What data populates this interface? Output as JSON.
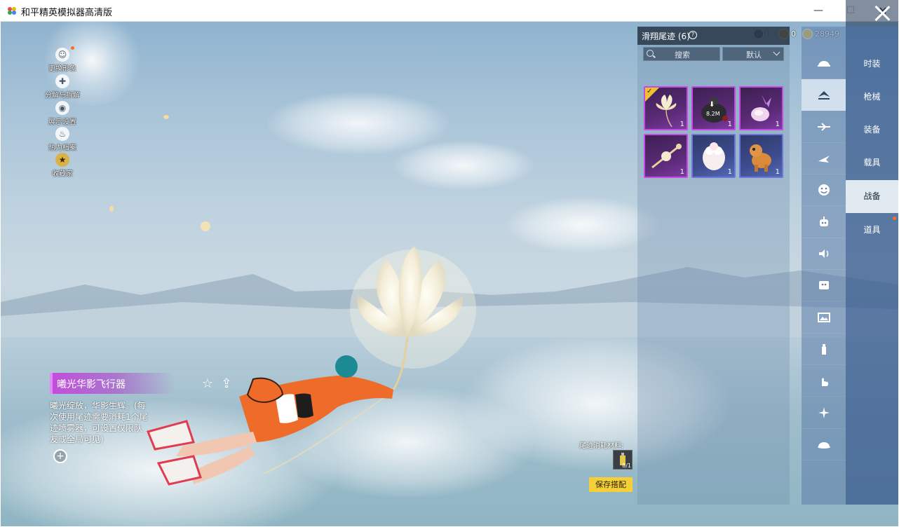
{
  "window": {
    "title": "和平精英模拟器高清版",
    "minimize": "—",
    "maximize": "☐",
    "close": "✕"
  },
  "side_menu": [
    {
      "label": "更换形象",
      "icon": "avatar-icon",
      "glyph": "☺"
    },
    {
      "label": "分解与拆解",
      "icon": "decompose-icon",
      "glyph": "✚"
    },
    {
      "label": "展示设置",
      "icon": "eye-icon",
      "glyph": "◉"
    },
    {
      "label": "热力档案",
      "icon": "flame-icon",
      "glyph": "♨"
    },
    {
      "label": "收藏家",
      "icon": "collector-badge-icon",
      "glyph": "★"
    }
  ],
  "currency": [
    {
      "icon": "silver-coin-icon",
      "value": "0",
      "color": "#5c6570"
    },
    {
      "icon": "gold-medal-icon",
      "value": "0",
      "color": "#c9a13a"
    },
    {
      "icon": "coupon-icon",
      "value": "28949",
      "color": "#e5c050"
    }
  ],
  "item": {
    "name": "曦光华影飞行器",
    "description": "曦光绽放，华影生辉。(每次使用尾迹需要消耗1个尾迹喷雾器，可设置仅限队友或全局可见)",
    "zoom": "+",
    "fav_glyph": "☆",
    "share_glyph": "⇪"
  },
  "panel": {
    "title": "滑翔尾迹 (6)",
    "help": "?",
    "search_placeholder": "搜索",
    "sort_value": "默认",
    "items": [
      {
        "name": "flower-glider",
        "count": "1",
        "rarity": "purple",
        "equipped": true,
        "art": "flower"
      },
      {
        "name": "pot-trail",
        "count": "1",
        "rarity": "purple",
        "equipped": false,
        "art": "pot",
        "download_size": "8.2M"
      },
      {
        "name": "turnip-trail",
        "count": "1",
        "rarity": "purple",
        "equipped": false,
        "art": "turnip"
      },
      {
        "name": "wand-trail",
        "count": "1",
        "rarity": "purple",
        "equipped": false,
        "art": "wand"
      },
      {
        "name": "alpaca-trail",
        "count": "1",
        "rarity": "blue",
        "equipped": false,
        "art": "alpaca"
      },
      {
        "name": "pony-trail",
        "count": "1",
        "rarity": "blue",
        "equipped": false,
        "art": "pony"
      }
    ]
  },
  "cost": {
    "label": "尾迹消耗材料:",
    "count": "8/1"
  },
  "save_button": "保存搭配",
  "categories": [
    {
      "icon": "hat-icon"
    },
    {
      "icon": "glider-trail-icon",
      "active": true
    },
    {
      "icon": "plane-icon"
    },
    {
      "icon": "parachute-plane-icon"
    },
    {
      "icon": "emote-icon"
    },
    {
      "icon": "companion-icon"
    },
    {
      "icon": "sound-icon"
    },
    {
      "icon": "sticker-icon"
    },
    {
      "icon": "photo-icon"
    },
    {
      "icon": "spray-icon"
    },
    {
      "icon": "gesture-icon"
    },
    {
      "icon": "sparkle-icon"
    },
    {
      "icon": "dome-icon"
    }
  ],
  "tabs": [
    {
      "label": "时装"
    },
    {
      "label": "枪械"
    },
    {
      "label": "装备"
    },
    {
      "label": "载具"
    },
    {
      "label": "战备",
      "active": true
    },
    {
      "label": "道具",
      "dot": true
    }
  ]
}
